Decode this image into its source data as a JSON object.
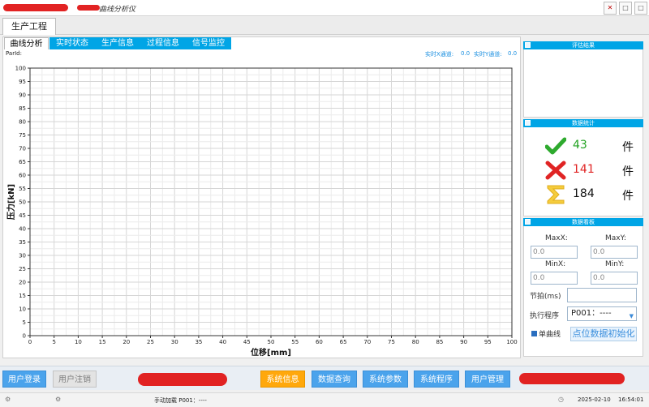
{
  "window": {
    "app_title": "曲线分析仪",
    "btn_close": "✕",
    "btn_max": "□",
    "btn_min": "□"
  },
  "top_tabs": [
    {
      "label": "生产工程",
      "active": true
    }
  ],
  "sub_tabs": [
    {
      "label": "曲线分析",
      "active": true
    },
    {
      "label": "实时状态",
      "active": false
    },
    {
      "label": "生产信息",
      "active": false
    },
    {
      "label": "过程信息",
      "active": false
    },
    {
      "label": "信号监控",
      "active": false
    }
  ],
  "info": {
    "parid_label": "ParId:",
    "realtime_x_label": "实时X通道:",
    "realtime_x_value": "0.0",
    "realtime_y_label": "实时Y通道:",
    "realtime_y_value": "0.0"
  },
  "chart_data": {
    "type": "line",
    "xlabel": "位移[mm]",
    "ylabel": "压力[kN]",
    "xlim": [
      0,
      100
    ],
    "ylim": [
      0,
      100
    ],
    "x_ticks": [
      0,
      5,
      10,
      15,
      20,
      25,
      30,
      35,
      40,
      45,
      50,
      55,
      60,
      65,
      70,
      75,
      80,
      85,
      90,
      95,
      100
    ],
    "y_ticks": [
      0,
      5,
      10,
      15,
      20,
      25,
      30,
      35,
      40,
      45,
      50,
      55,
      60,
      65,
      70,
      75,
      80,
      85,
      90,
      95,
      100
    ],
    "grid": true,
    "series": []
  },
  "right_panel": {
    "eval_title": "评估结果",
    "stats_title": "数据统计",
    "stats": [
      {
        "icon": "check-icon",
        "value": "43",
        "unit": "件",
        "color": "#23a323"
      },
      {
        "icon": "cross-icon",
        "value": "141",
        "unit": "件",
        "color": "#e02424"
      },
      {
        "icon": "sum-icon",
        "value": "184",
        "unit": "件",
        "color": "#111111"
      }
    ],
    "dashboard_title": "数据看板",
    "maxx_label": "MaxX:",
    "maxy_label": "MaxY:",
    "maxx_value": "0.0",
    "maxy_value": "0.0",
    "minx_label": "MinX:",
    "miny_label": "MinY:",
    "minx_value": "0.0",
    "miny_value": "0.0",
    "cycle_label": "节拍(ms)",
    "program_label": "执行程序",
    "program_value": "P001：----",
    "single_curve_label": "单曲线",
    "init_button": "点位数据初始化"
  },
  "toolbar": {
    "login": "用户登录",
    "logout": "用户注销",
    "sys_info": "系统信息",
    "data_query": "数据查询",
    "sys_params": "系统参数",
    "sys_program": "系统程序",
    "user_mgmt": "用户管理"
  },
  "status": {
    "load_text": "手动加载 P001：----",
    "date": "2025-02-10",
    "time": "16:54:01"
  },
  "colors": {
    "accent": "#00a5e6",
    "button_blue": "#4aa3ec",
    "button_orange": "#ffa80c"
  }
}
